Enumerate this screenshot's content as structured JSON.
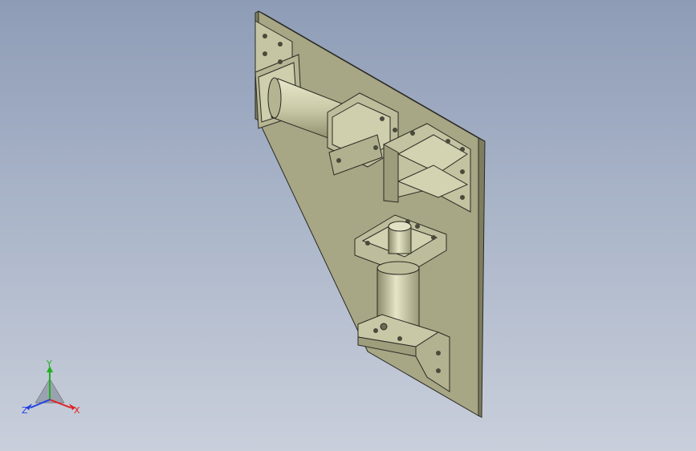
{
  "viewport": {
    "background_top": "#8e9cb6",
    "background_bottom": "#c9cfdb",
    "part_color": "#c8c7a4",
    "part_shadow": "#8f8e6e",
    "edge_color": "#2a2a24"
  },
  "triad": {
    "x_label": "X",
    "y_label": "Y",
    "z_label": "Z",
    "x_color": "#e02020",
    "y_color": "#20b020",
    "z_color": "#2040e0"
  }
}
